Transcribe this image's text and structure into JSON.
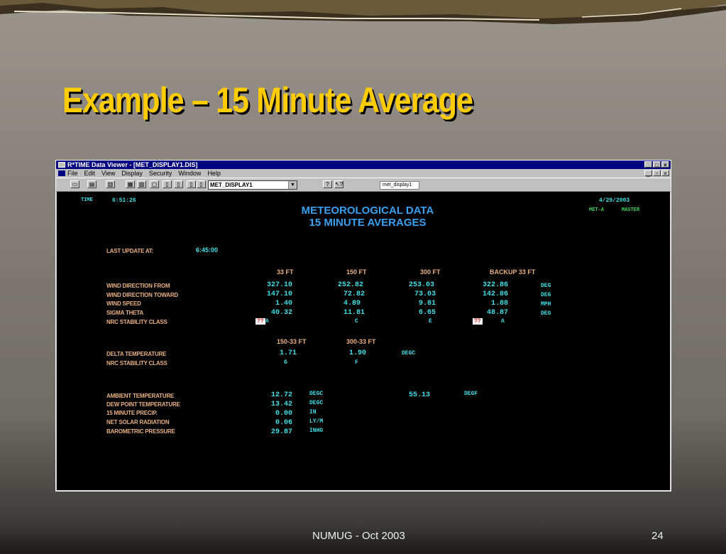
{
  "slide": {
    "title": "Example – 15 Minute Average",
    "footer_left": "NUMUG - Oct 2003",
    "page_number": "24",
    "title_color": "#ffcc00"
  },
  "window": {
    "title": "R*TIME Data Viewer - [MET_DISPLAY1.DIS]",
    "menus": [
      "File",
      "Edit",
      "View",
      "Display",
      "Security",
      "Window",
      "Help"
    ],
    "display_select": "MET_DISPLAY1",
    "display_input": "met_display1",
    "title_bar_color": "#000080"
  },
  "screen": {
    "time_label": "TIME",
    "time_value": "6:51:26",
    "date_value": "4/29/2003",
    "mode_left": "MET-A",
    "mode_right": "MASTER",
    "heading_line1": "METEOROLOGICAL DATA",
    "heading_line2": "15 MINUTE AVERAGES",
    "last_update_label": "LAST UPDATE AT:",
    "last_update_value": "6:45:00",
    "columns": [
      "33 FT",
      "150 FT",
      "300 FT",
      "BACKUP 33 FT"
    ],
    "rows": [
      {
        "label": "WIND DIRECTION FROM",
        "values": [
          "327.10",
          "252.82",
          "253.03",
          "322.86"
        ],
        "unit": "DEG"
      },
      {
        "label": "WIND DIRECTION TOWARD",
        "values": [
          "147.10",
          "72.82",
          "73.03",
          "142.86"
        ],
        "unit": "DEG"
      },
      {
        "label": "WIND SPEED",
        "values": [
          "1.40",
          "4.89",
          "9.81",
          "1.88"
        ],
        "unit": "MPH"
      },
      {
        "label": "SIGMA THETA",
        "values": [
          "40.32",
          "11.81",
          "6.65",
          "48.87"
        ],
        "unit": "DEG"
      }
    ],
    "stability": {
      "label": "NRC STABILITY CLASS",
      "flag_33": "??",
      "class_33": "A",
      "class_150": "C",
      "class_300": "E",
      "flag_backup": "??",
      "class_backup": "A"
    },
    "delta_columns": [
      "150-33 FT",
      "300-33 FT"
    ],
    "delta_temp": {
      "label": "DELTA TEMPERATURE",
      "values": [
        "1.71",
        "1.90"
      ],
      "unit": "DEGC"
    },
    "delta_stability": {
      "label": "NRC STABILITY CLASS",
      "values": [
        "G",
        "F"
      ]
    },
    "ambient": [
      {
        "label": "AMBIENT TEMPERATURE",
        "value": "12.72",
        "unit": "DEGC",
        "value2": "55.13",
        "unit2": "DEGF"
      },
      {
        "label": "DEW POINT TEMPERATURE",
        "value": "13.42",
        "unit": "DEGC"
      },
      {
        "label": "15 MINUTE PRECIP.",
        "value": "0.00",
        "unit": "IN"
      },
      {
        "label": "NET SOLAR RADIATION",
        "value": "0.06",
        "unit": "LY/M"
      },
      {
        "label": "BAROMETRIC PRESSURE",
        "value": "29.87",
        "unit": "INHG"
      }
    ],
    "colors": {
      "label": "#e8b080",
      "value": "#40e0e8",
      "heading": "#3aa0f0",
      "status": "#40d060",
      "alarm": "#ff2020"
    }
  }
}
